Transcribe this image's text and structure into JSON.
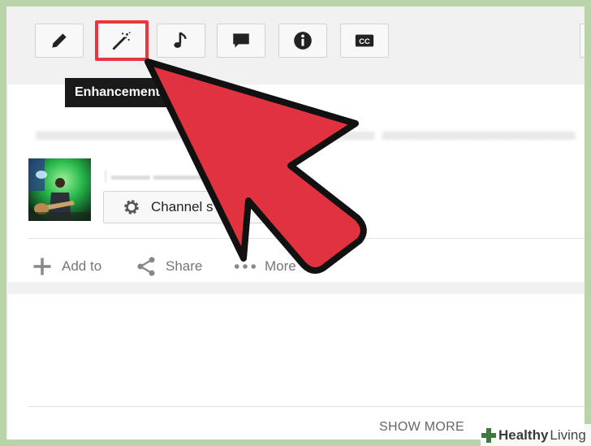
{
  "toolbar": {
    "buttons": [
      {
        "name": "pencil-icon"
      },
      {
        "name": "magic-wand-icon",
        "active": true
      },
      {
        "name": "music-note-icon"
      },
      {
        "name": "speech-bubble-icon"
      },
      {
        "name": "info-icon"
      },
      {
        "name": "cc-icon",
        "label": "CC"
      }
    ],
    "tooltip": "Enhancements"
  },
  "video": {
    "channel_settings_label": "Channel s"
  },
  "actions": {
    "add_to": "Add to",
    "share": "Share",
    "more": "More"
  },
  "description": {
    "show_more": "SHOW MORE"
  },
  "watermark": {
    "bold": "Healthy",
    "light": "Living"
  },
  "colors": {
    "highlight": "#e8383d",
    "arrow_fill": "#e0323f",
    "tooltip_bg": "#1a1a1a",
    "background": "#b9d4a7"
  }
}
